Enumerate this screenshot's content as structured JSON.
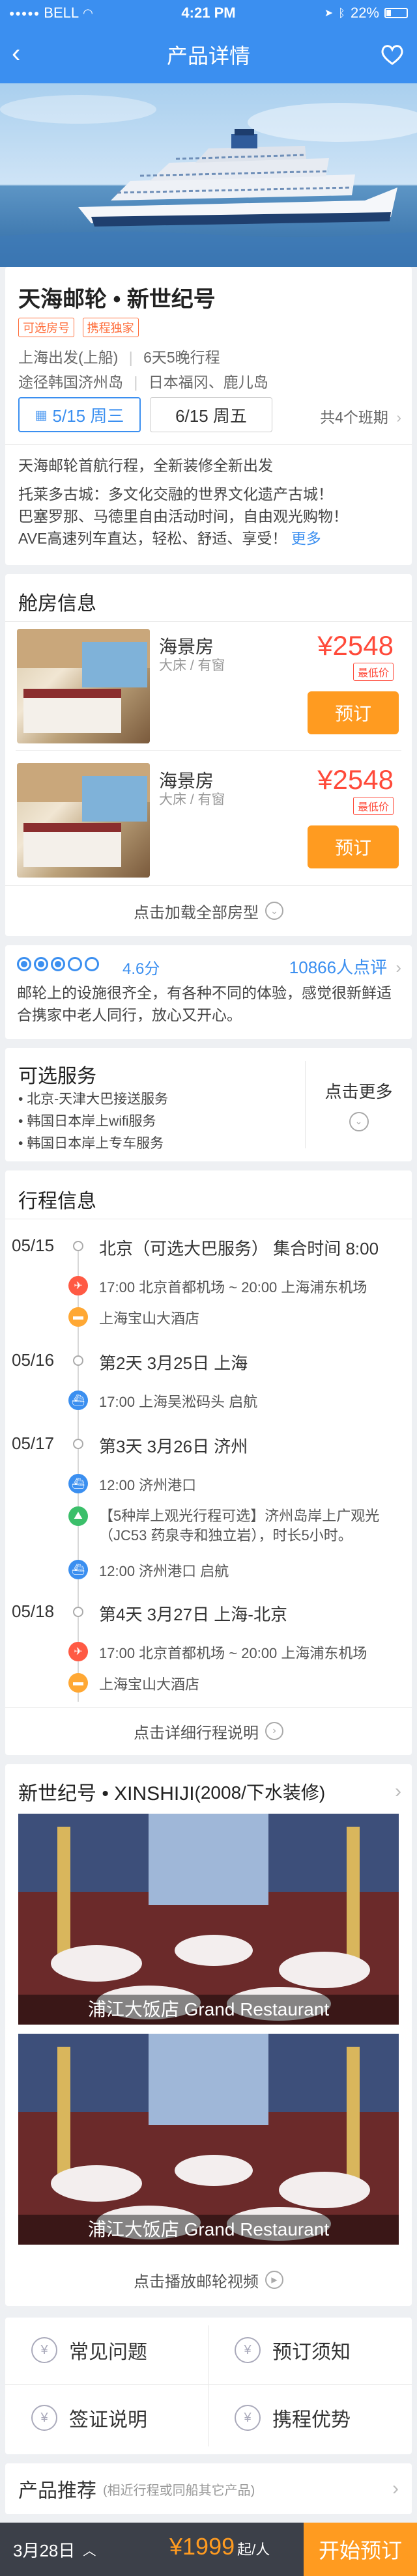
{
  "status_bar": {
    "carrier": "BELL",
    "time": "4:21 PM",
    "battery": "22%"
  },
  "nav": {
    "title": "产品详情"
  },
  "product": {
    "title": "天海邮轮 • 新世纪号",
    "tags": [
      "可选房号",
      "携程独家"
    ],
    "departure": "上海出发(上船)",
    "duration": "6天5晚行程",
    "route_label": "途径韩国济州岛",
    "route_ports": "日本福冈、鹿儿岛",
    "date_selected": "5/15 周三",
    "date_other": "6/15 周五",
    "schedule_count": "共4个班期",
    "desc_line1": "天海邮轮首航行程，全新装修全新出发",
    "desc_line2": "托莱多古城：多文化交融的世界文化遗产古城！",
    "desc_line3": "巴塞罗那、马德里自由活动时间，自由观光购物！",
    "desc_line4": "AVE高速列车直达，轻松、舒适、享受！",
    "more": "更多"
  },
  "cabin": {
    "section_title": "舱房信息",
    "rooms": [
      {
        "name": "海景房",
        "sub": "大床 / 有窗",
        "price": "¥2548",
        "badge": "最低价",
        "book": "预订"
      },
      {
        "name": "海景房",
        "sub": "大床 / 有窗",
        "price": "¥2548",
        "badge": "最低价",
        "book": "预订"
      }
    ],
    "load_all": "点击加载全部房型"
  },
  "review": {
    "score": "4.6分",
    "count": "10866人点评",
    "rating_dots": 3,
    "text": "邮轮上的设施很齐全，有各种不同的体验，感觉很新鲜适合携家中老人同行，放心又开心。"
  },
  "services": {
    "title": "可选服务",
    "items": [
      "北京-天津大巴接送服务",
      "韩国日本岸上wifi服务",
      "韩国日本岸上专车服务"
    ],
    "more": "点击更多"
  },
  "itinerary": {
    "title": "行程信息",
    "d1_date": "05/15",
    "d1_head": "北京（可选大巴服务） 集合时间 8:00",
    "d1_flight": "17:00 北京首都机场 ~ 20:00 上海浦东机场",
    "d1_hotel": "上海宝山大酒店",
    "d2_date": "05/16",
    "d2_head": "第2天   3月25日   上海",
    "d2_ship": "17:00 上海吴淞码头 启航",
    "d3_date": "05/17",
    "d3_head": "第3天   3月26日   济州",
    "d3_port": "12:00 济州港口",
    "d3_tour1": "【5种岸上观光行程可选】济州岛岸上广观光",
    "d3_tour2": "（JC53 药泉寺和独立岩），时长5小时。",
    "d3_depart": "12:00 济州港口 启航",
    "d4_date": "05/18",
    "d4_head": "第4天   3月27日   上海-北京",
    "d4_flight": "17:00 北京首都机场 ~ 20:00 上海浦东机场",
    "d4_hotel": "上海宝山大酒店",
    "detail": "点击详细行程说明"
  },
  "ship": {
    "title": "新世纪号 • XINSHIJI",
    "title_suffix": "(2008/下水装修)",
    "img1_caption": "浦江大饭店 Grand Restaurant",
    "img2_caption": "浦江大饭店 Grand Restaurant",
    "video": "点击播放邮轮视频"
  },
  "links": {
    "faq": "常见问题",
    "booking_notice": "预订须知",
    "visa": "签证说明",
    "advantage": "携程优势"
  },
  "recommend": {
    "title": "产品推荐",
    "sub": "(相近行程或同船其它产品)"
  },
  "bottom": {
    "date": "3月28日",
    "price": "¥1999",
    "unit": "起/人",
    "book": "开始预订"
  },
  "colors": {
    "primary": "#3b8ff0",
    "accent": "#ff9b20",
    "price": "#ff4a3a"
  }
}
